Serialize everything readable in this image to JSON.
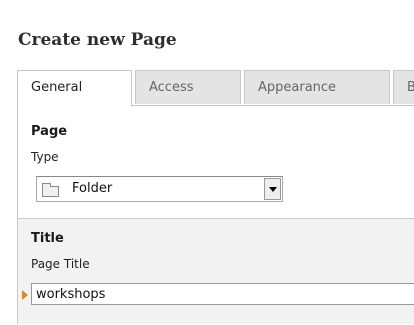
{
  "heading": "Create new Page",
  "tabs": [
    {
      "label": "General",
      "active": true
    },
    {
      "label": "Access",
      "active": false
    },
    {
      "label": "Appearance",
      "active": false
    },
    {
      "label": "B",
      "active": false
    }
  ],
  "page_section": {
    "heading": "Page",
    "type_label": "Type",
    "type_value": "Folder",
    "type_icon": "folder-icon"
  },
  "title_section": {
    "heading": "Title",
    "page_title_label": "Page Title",
    "page_title_value": "workshops"
  },
  "colors": {
    "required_marker": "#d68a1f",
    "tab_inactive_bg": "#e4e4e4",
    "title_section_bg": "#f2f2f2"
  }
}
